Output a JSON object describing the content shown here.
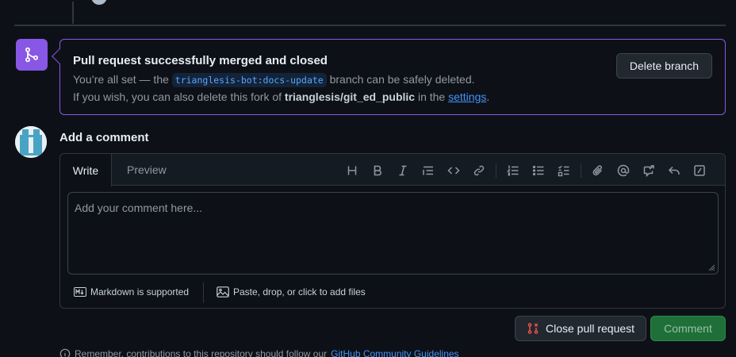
{
  "merge": {
    "title": "Pull request successfully merged and closed",
    "line1_prefix": "You’re all set — the",
    "branch": "trianglesis-bot:docs-update",
    "line1_suffix": "branch can be safely deleted.",
    "line2_prefix": "If you wish, you can also delete this fork of",
    "repo": "trianglesis/git_ed_public",
    "line2_middle": "in the",
    "settings_link": "settings",
    "line2_end": ".",
    "delete_button": "Delete branch",
    "icon": "git-merge-icon"
  },
  "comment": {
    "title": "Add a comment",
    "tabs": {
      "write": "Write",
      "preview": "Preview"
    },
    "placeholder": "Add your comment here...",
    "markdown_note": "Markdown is supported",
    "attach_note": "Paste, drop, or click to add files",
    "toolbar_icons": [
      "heading-icon",
      "bold-icon",
      "italic-icon",
      "quote-icon",
      "code-icon",
      "link-icon",
      "numbered-list-icon",
      "bullet-list-icon",
      "task-list-icon",
      "attach-icon",
      "mention-icon",
      "cross-reference-icon",
      "saved-reply-icon",
      "slash-command-icon"
    ]
  },
  "actions": {
    "close_pr": "Close pull request",
    "comment": "Comment"
  },
  "footer": {
    "guidelines_prefix": "Remember, contributions to this repository should follow our",
    "guidelines_link": "GitHub Community Guidelines"
  },
  "colors": {
    "background": "#0d1117",
    "merged_purple": "#8957e5",
    "link_blue": "#4493f8",
    "comment_green": "#1f6f38",
    "close_red": "#f85149"
  }
}
